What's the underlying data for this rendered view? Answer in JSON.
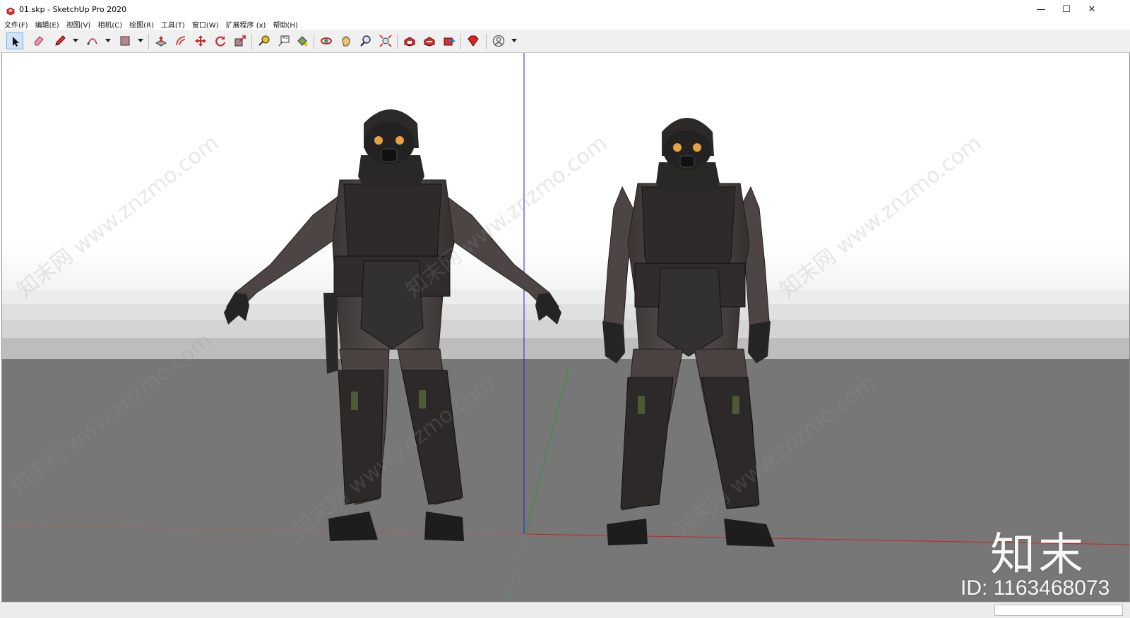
{
  "window": {
    "title": "01.skp - SketchUp Pro 2020",
    "minimize_glyph": "—",
    "maximize_glyph": "☐",
    "close_glyph": "✕"
  },
  "menu": [
    "文件(F)",
    "编辑(E)",
    "视图(V)",
    "相机(C)",
    "绘图(R)",
    "工具(T)",
    "窗口(W)",
    "扩展程序 (x)",
    "帮助(H)"
  ],
  "toolbar": {
    "tools": [
      "select-icon",
      "eraser-icon",
      "pencil-icon",
      "arc-icon",
      "rectangle-icon",
      "push-pull-icon",
      "offset-icon",
      "move-icon",
      "rotate-icon",
      "scale-icon",
      "tape-measure-icon",
      "text-icon",
      "paint-bucket-icon",
      "orbit-icon",
      "pan-icon",
      "zoom-icon",
      "zoom-extents-icon",
      "warehouse-icon",
      "extension-warehouse-icon",
      "share-model-icon",
      "ruby-console-icon",
      "account-icon"
    ],
    "text_tool_label": "A1"
  },
  "watermark": {
    "brand": "知末",
    "id": "ID: 1163468073",
    "diagonal": "知末网 www.znzmo.com"
  },
  "colors": {
    "red_axis": "#cc2222",
    "green_axis": "#2a9a2a",
    "blue_axis": "#2222cc",
    "ground": "#7a7a7a",
    "sky": "#ffffff",
    "active_tool": "#cde4f7"
  }
}
